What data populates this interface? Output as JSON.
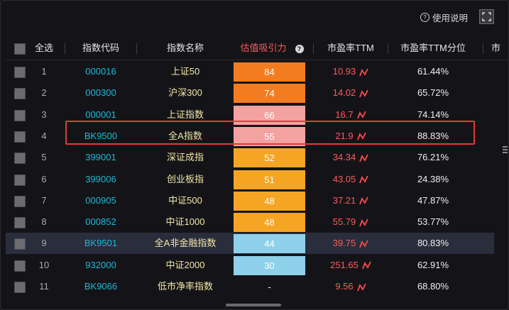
{
  "topbar": {
    "help_label": "使用说明"
  },
  "header": {
    "select_all": "全选",
    "code": "指数代码",
    "name": "指数名称",
    "attraction": "估值吸引力",
    "pe": "市盈率TTM",
    "pe_pct": "市盈率TTM分位",
    "more": "市"
  },
  "colors": {
    "orange_dark": "#f47c20",
    "salmon": "#f4a1a1",
    "orange": "#f5a524",
    "light_blue": "#8fd1ea",
    "code": "#1fb8d8",
    "name": "#f2e6a8",
    "pe": "#ff5a5a",
    "highlight_box": "#e23a3a"
  },
  "rows": [
    {
      "index": "1",
      "code": "000016",
      "name": "上证50",
      "attraction": "84",
      "attraction_color": "#f47c20",
      "pe": "10.93",
      "pe_pct": "61.44%"
    },
    {
      "index": "2",
      "code": "000300",
      "name": "沪深300",
      "attraction": "74",
      "attraction_color": "#f47c20",
      "pe": "14.02",
      "pe_pct": "65.72%"
    },
    {
      "index": "3",
      "code": "000001",
      "name": "上证指数",
      "attraction": "66",
      "attraction_color": "#f4a1a1",
      "pe": "16.7",
      "pe_pct": "74.14%"
    },
    {
      "index": "4",
      "code": "BK9500",
      "name": "全A指数",
      "attraction": "55",
      "attraction_color": "#f4a1a1",
      "pe": "21.9",
      "pe_pct": "88.83%"
    },
    {
      "index": "5",
      "code": "399001",
      "name": "深证成指",
      "attraction": "52",
      "attraction_color": "#f5a524",
      "pe": "34.34",
      "pe_pct": "76.21%"
    },
    {
      "index": "6",
      "code": "399006",
      "name": "创业板指",
      "attraction": "51",
      "attraction_color": "#f5a524",
      "pe": "43.05",
      "pe_pct": "24.38%"
    },
    {
      "index": "7",
      "code": "000905",
      "name": "中证500",
      "attraction": "48",
      "attraction_color": "#f5a524",
      "pe": "37.21",
      "pe_pct": "47.87%"
    },
    {
      "index": "8",
      "code": "000852",
      "name": "中证1000",
      "attraction": "48",
      "attraction_color": "#f5a524",
      "pe": "55.79",
      "pe_pct": "53.77%"
    },
    {
      "index": "9",
      "code": "BK9501",
      "name": "全A非金融指数",
      "attraction": "44",
      "attraction_color": "#8fd1ea",
      "pe": "39.75",
      "pe_pct": "80.83%"
    },
    {
      "index": "10",
      "code": "932000",
      "name": "中证2000",
      "attraction": "30",
      "attraction_color": "#8fd1ea",
      "pe": "251.65",
      "pe_pct": "62.91%"
    },
    {
      "index": "11",
      "code": "BK9066",
      "name": "低市净率指数",
      "attraction": "-",
      "attraction_color": "",
      "pe": "9.56",
      "pe_pct": "68.80%"
    }
  ]
}
